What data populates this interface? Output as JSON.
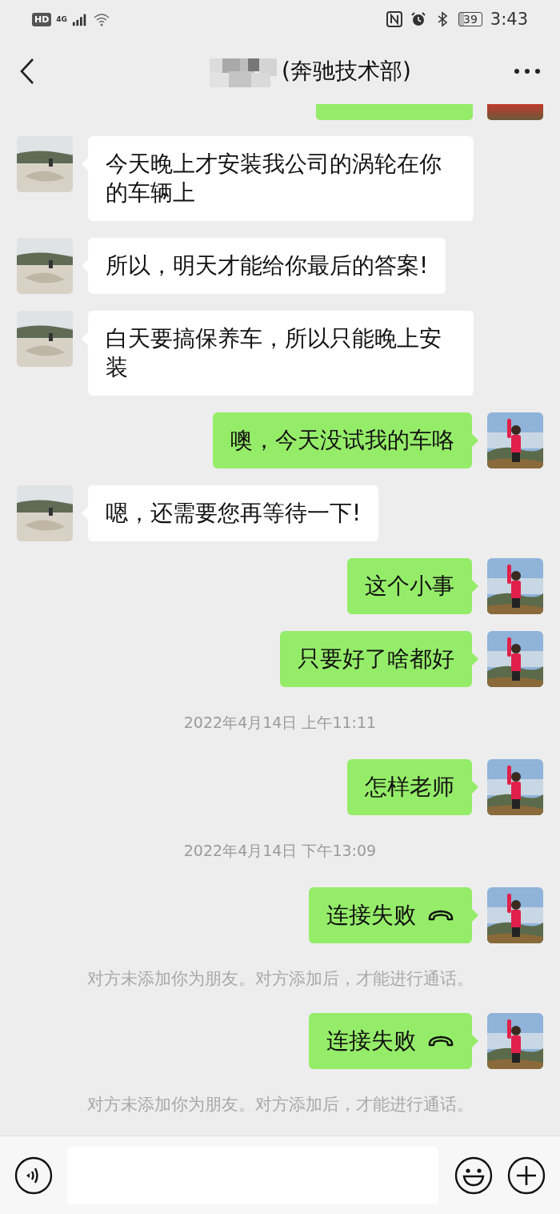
{
  "status_bar": {
    "badge": "HD",
    "network": "4G",
    "battery": "39",
    "time": "3:43"
  },
  "header": {
    "title": "(奔驰技术部)",
    "name_blurred": true
  },
  "messages": [
    {
      "kind": "cut_sent"
    },
    {
      "kind": "received",
      "text": "今天晚上才安装我公司的涡轮在你的车辆上"
    },
    {
      "kind": "received",
      "text": "所以，明天才能给你最后的答案!"
    },
    {
      "kind": "received",
      "text": "白天要搞保养车，所以只能晚上安装"
    },
    {
      "kind": "sent",
      "text": "噢，今天没试我的车咯"
    },
    {
      "kind": "received",
      "text": "嗯，还需要您再等待一下!"
    },
    {
      "kind": "sent",
      "text": "这个小事"
    },
    {
      "kind": "sent",
      "text": "只要好了啥都好"
    },
    {
      "kind": "time",
      "text": "2022年4月14日 上午11:11"
    },
    {
      "kind": "sent",
      "text": "怎样老师"
    },
    {
      "kind": "time",
      "text": "2022年4月14日 下午13:09"
    },
    {
      "kind": "call",
      "text": "连接失败"
    },
    {
      "kind": "notice",
      "text": "对方未添加你为朋友。对方添加后，才能进行通话。"
    },
    {
      "kind": "call",
      "text": "连接失败"
    },
    {
      "kind": "notice",
      "text": "对方未添加你为朋友。对方添加后，才能进行通话。"
    }
  ]
}
